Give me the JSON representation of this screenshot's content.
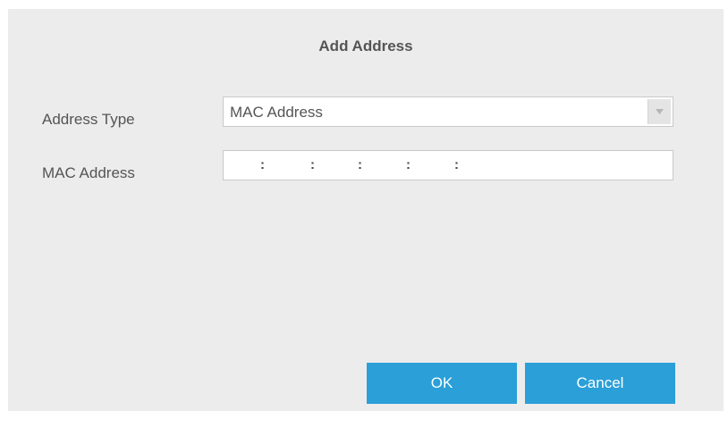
{
  "dialog": {
    "title": "Add Address",
    "address_type_label": "Address Type",
    "address_type_value": "MAC Address",
    "mac_address_label": "MAC Address",
    "mac_separators": [
      ":",
      ":",
      ":",
      ":",
      ":"
    ],
    "ok_label": "OK",
    "cancel_label": "Cancel"
  },
  "colors": {
    "dialog_bg": "#ececec",
    "button_bg": "#2a9fd8",
    "text": "#555555"
  }
}
